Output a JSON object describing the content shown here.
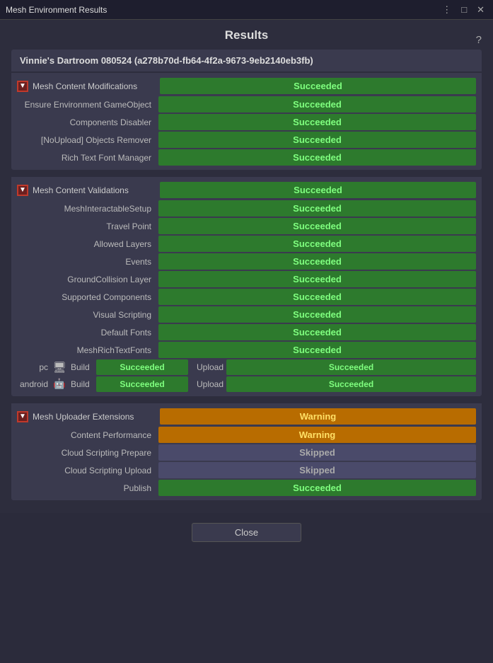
{
  "window": {
    "title": "Mesh Environment Results",
    "controls": [
      "⋮",
      "□",
      "✕"
    ]
  },
  "page": {
    "title": "Results",
    "help_icon": "?",
    "env_header": "Vinnie's Dartroom 080524 (a278b70d-fb64-4f2a-9673-9eb2140eb3fb)",
    "sections": [
      {
        "id": "mesh-content-modifications",
        "label": "Mesh Content Modifications",
        "status": "Succeeded",
        "status_type": "green",
        "rows": [
          {
            "label": "Ensure Environment GameObject",
            "status": "Succeeded",
            "status_type": "green"
          },
          {
            "label": "Components Disabler",
            "status": "Succeeded",
            "status_type": "green"
          },
          {
            "label": "[NoUpload] Objects Remover",
            "status": "Succeeded",
            "status_type": "green"
          },
          {
            "label": "Rich Text Font Manager",
            "status": "Succeeded",
            "status_type": "green"
          }
        ]
      },
      {
        "id": "mesh-content-validations",
        "label": "Mesh Content Validations",
        "status": "Succeeded",
        "status_type": "green",
        "rows": [
          {
            "label": "MeshInteractableSetup",
            "status": "Succeeded",
            "status_type": "green"
          },
          {
            "label": "Travel Point",
            "status": "Succeeded",
            "status_type": "green"
          },
          {
            "label": "Allowed Layers",
            "status": "Succeeded",
            "status_type": "green"
          },
          {
            "label": "Events",
            "status": "Succeeded",
            "status_type": "green"
          },
          {
            "label": "GroundCollision Layer",
            "status": "Succeeded",
            "status_type": "green"
          },
          {
            "label": "Supported Components",
            "status": "Succeeded",
            "status_type": "green"
          },
          {
            "label": "Visual Scripting",
            "status": "Succeeded",
            "status_type": "green"
          },
          {
            "label": "Default Fonts",
            "status": "Succeeded",
            "status_type": "green"
          },
          {
            "label": "MeshRichTextFonts",
            "status": "Succeeded",
            "status_type": "green"
          }
        ],
        "build_upload": [
          {
            "platform": "pc",
            "icon": "monitor",
            "build_label": "Build",
            "build_status": "Succeeded",
            "build_type": "green",
            "upload_label": "Upload",
            "upload_status": "Succeeded",
            "upload_type": "green"
          },
          {
            "platform": "android",
            "icon": "android",
            "build_label": "Build",
            "build_status": "Succeeded",
            "build_type": "green",
            "upload_label": "Upload",
            "upload_status": "Succeeded",
            "upload_type": "green"
          }
        ]
      },
      {
        "id": "mesh-uploader-extensions",
        "label": "Mesh Uploader Extensions",
        "status": "Warning",
        "status_type": "orange",
        "rows": [
          {
            "label": "Content Performance",
            "status": "Warning",
            "status_type": "orange"
          },
          {
            "label": "Cloud Scripting Prepare",
            "status": "Skipped",
            "status_type": "skipped"
          },
          {
            "label": "Cloud Scripting Upload",
            "status": "Skipped",
            "status_type": "skipped"
          },
          {
            "label": "Publish",
            "status": "Succeeded",
            "status_type": "green"
          }
        ]
      }
    ],
    "close_button": "Close"
  }
}
